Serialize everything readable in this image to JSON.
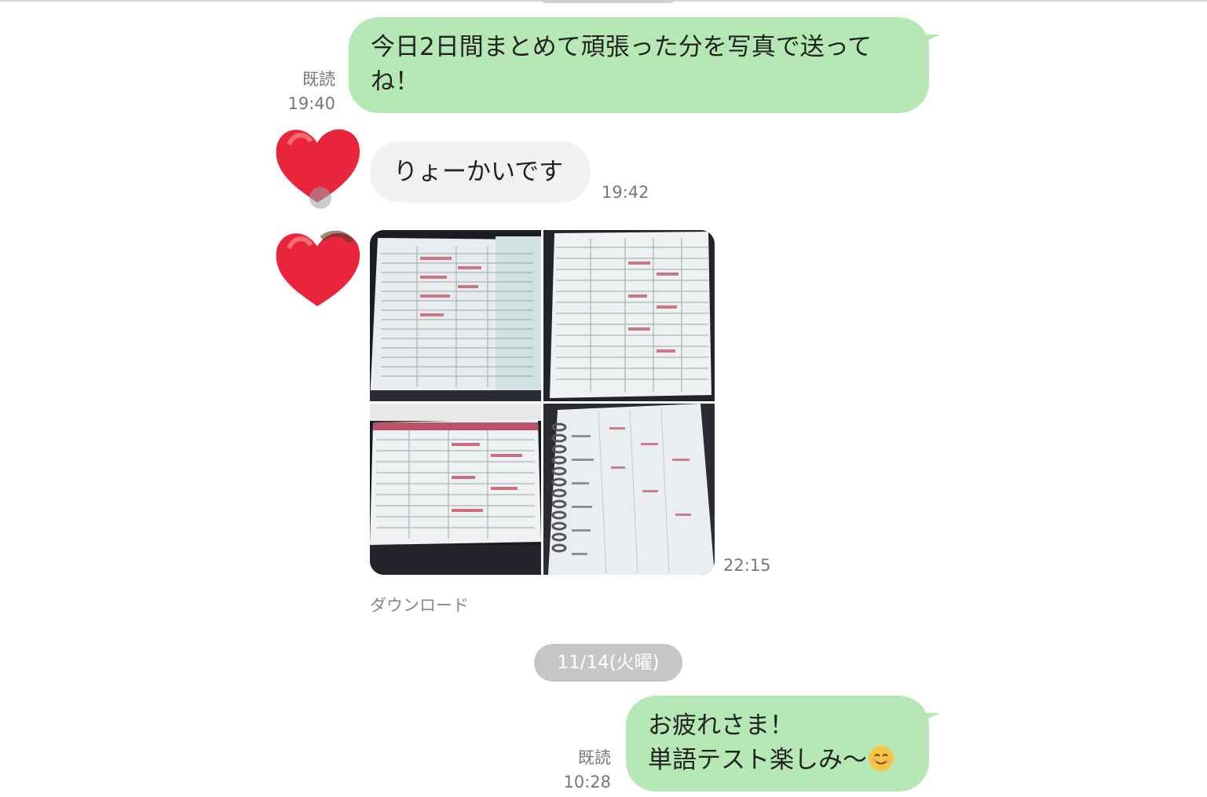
{
  "messages": {
    "m1": {
      "line1": "今日2日間まとめて頑張った分を写真で送って",
      "line2": "ね！",
      "read": "既読",
      "time": "19:40"
    },
    "m2": {
      "text": "りょーかいです",
      "time": "19:42"
    },
    "m3": {
      "time": "22:15",
      "download": "ダウンロード"
    },
    "date_separator": "11/14(火曜)",
    "m4": {
      "line1": "お疲れさま！",
      "line2": "単語テスト楽しみ〜",
      "emoji": "smiling-face-icon",
      "read": "既読",
      "time": "10:28"
    }
  },
  "colors": {
    "outgoing_bubble": "#b6e8b6",
    "incoming_bubble": "#f0f1f3",
    "date_pill": "#c6c6c6",
    "avatar_heart": "#e8253a"
  }
}
